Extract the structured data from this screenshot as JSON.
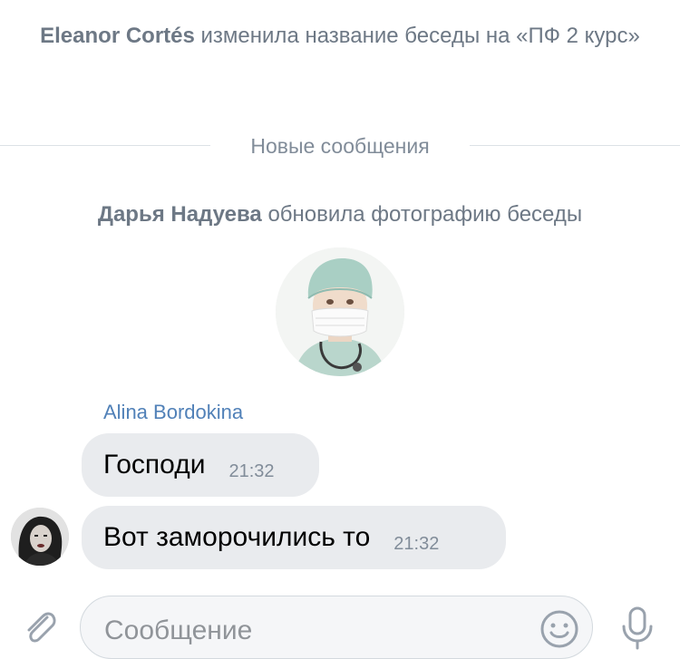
{
  "conversation": {
    "rename_event": {
      "actor": "Eleanor Cortés",
      "action": "изменила название беседы на «ПФ 2 курс»"
    },
    "new_messages_label": "Новые сообщения",
    "photo_event": {
      "actor": "Дарья Надуева",
      "action": "обновила фотографию беседы"
    },
    "messages": [
      {
        "sender": "Alina Bordokina",
        "text": "Господи",
        "time": "21:32"
      },
      {
        "text": "Вот заморочились то",
        "time": "21:32"
      }
    ]
  },
  "composer": {
    "placeholder": "Сообщение"
  },
  "colors": {
    "accent": "#5181b8",
    "bubble": "#e9ebee",
    "meta_text": "#818c99"
  },
  "icons": [
    "attach-icon",
    "emoji-icon",
    "microphone-icon"
  ]
}
